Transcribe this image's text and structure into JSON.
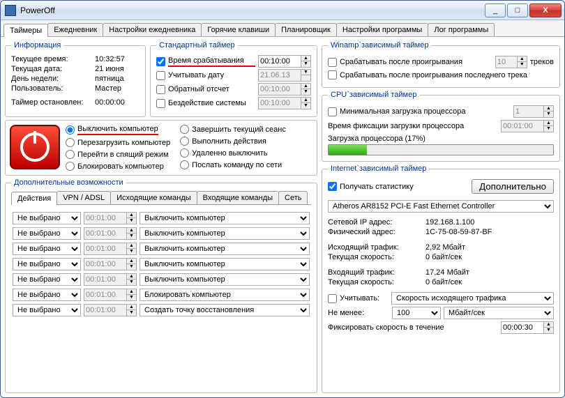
{
  "window": {
    "title": "PowerOff"
  },
  "titlebar_buttons": {
    "minimize": "_",
    "maximize": "□",
    "close": "X"
  },
  "tabs": {
    "items": [
      "Таймеры",
      "Ежедневник",
      "Настройки ежедневника",
      "Горячие клавиши",
      "Планировщик",
      "Настройки программы",
      "Лог программы"
    ],
    "active": 0
  },
  "info": {
    "legend": "Информация",
    "current_time_label": "Текущее время:",
    "current_time": "10:32:57",
    "current_date_label": "Текущая дата:",
    "current_date": "21 июня",
    "weekday_label": "День недели:",
    "weekday": "пятница",
    "user_label": "Пользователь:",
    "user": "Мастер",
    "timer_stopped_label": "Таймер остановлен:",
    "timer_stopped": "00:00:00"
  },
  "std_timer": {
    "legend": "Стандартный таймер",
    "trigger_time_label": "Время срабатывания",
    "trigger_time_checked": true,
    "trigger_time": "00:10:00",
    "use_date_label": "Учитывать дату",
    "use_date_checked": false,
    "use_date": "21.06.13",
    "countdown_label": "Обратный отсчет",
    "countdown_checked": false,
    "countdown": "00:10:00",
    "idle_label": "Бездействие системы",
    "idle_checked": false,
    "idle": "00:10:00"
  },
  "actions": {
    "radios_left": [
      {
        "label": "Выключить компьютер",
        "checked": true,
        "underline": true
      },
      {
        "label": "Перезагрузить компьютер",
        "checked": false
      },
      {
        "label": "Перейти в спящий режим",
        "checked": false
      },
      {
        "label": "Блокировать компьютер",
        "checked": false
      }
    ],
    "radios_right": [
      {
        "label": "Завершить текущий сеанс",
        "checked": false
      },
      {
        "label": "Выполнить действия",
        "checked": false
      },
      {
        "label": "Удаленно выключить",
        "checked": false
      },
      {
        "label": "Послать команду по сети",
        "checked": false
      }
    ]
  },
  "extra": {
    "legend": "Дополнительные возможности",
    "tabs": [
      "Действия",
      "VPN / ADSL",
      "Исходящие команды",
      "Входящие команды",
      "Сеть"
    ],
    "active": 0,
    "rows": [
      {
        "cond": "Не выбрано",
        "time": "00:01:00",
        "action": "Выключить компьютер"
      },
      {
        "cond": "Не выбрано",
        "time": "00:01:00",
        "action": "Выключить компьютер"
      },
      {
        "cond": "Не выбрано",
        "time": "00:01:00",
        "action": "Выключить компьютер"
      },
      {
        "cond": "Не выбрано",
        "time": "00:01:00",
        "action": "Выключить компьютер"
      },
      {
        "cond": "Не выбрано",
        "time": "00:01:00",
        "action": "Выключить компьютер"
      },
      {
        "cond": "Не выбрано",
        "time": "00:01:00",
        "action": "Блокировать компьютер"
      },
      {
        "cond": "Не выбрано",
        "time": "00:01:00",
        "action": "Создать точку восстановления"
      }
    ]
  },
  "winamp": {
    "legend": "Winamp`зависимый таймер",
    "after_play_label": "Срабатывать после проигрывания",
    "after_play_checked": false,
    "tracks_count": "10",
    "tracks_suffix": "треков",
    "after_last_label": "Срабатывать после проигрывания последнего трека",
    "after_last_checked": false
  },
  "cpu": {
    "legend": "CPU`зависимый таймер",
    "min_load_label": "Минимальная загрузка процессора",
    "min_load_checked": false,
    "min_load_value": "1",
    "fix_time_label": "Время фиксации загрузки процессора",
    "fix_time_value": "00:01:00",
    "load_label": "Загрузка процессора (17%)",
    "load_percent": 17
  },
  "internet": {
    "legend": "Internet`зависимый таймер",
    "get_stats_label": "Получать статистику",
    "get_stats_checked": true,
    "extra_button": "Дополнительно",
    "adapter": "Atheros AR8152 PCI-E Fast Ethernet Controller",
    "ip_label": "Сетевой IP адрес:",
    "ip": "192.168.1.100",
    "mac_label": "Физический адрес:",
    "mac": "1C-75-08-59-87-BF",
    "out_label": "Исходящий трафик:",
    "out": "2,92 Мбайт",
    "out_speed_label": "Текущая скорость:",
    "out_speed": "0 байт/сек",
    "in_label": "Входящий трафик:",
    "in": "17,24 Мбайт",
    "in_speed_label": "Текущая скорость:",
    "in_speed": "0 байт/сек",
    "consider_label": "Учитывать:",
    "consider_checked": false,
    "consider_value": "Скорость исходящего трафика",
    "not_less_label": "Не менее:",
    "not_less_value": "100",
    "not_less_unit": "Мбайт/сек",
    "fix_speed_label": "Фиксировать скорость в течение",
    "fix_speed_value": "00:00:30"
  }
}
